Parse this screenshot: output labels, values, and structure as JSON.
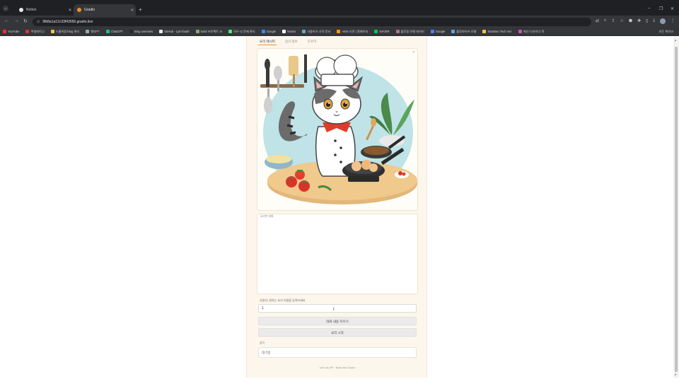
{
  "browser": {
    "tabs": [
      {
        "title": "Notion",
        "active": false,
        "favicon_color": "#e8e8e8"
      },
      {
        "title": "Gradio",
        "active": true,
        "favicon_color": "#f28c28"
      }
    ],
    "url": "9fb8a1a12c33f42656.gradio.live",
    "bookmarks": [
      {
        "label": "YouTube",
        "color": "#ff2d2d"
      },
      {
        "label": "쿠팡파트너",
        "color": "#d33"
      },
      {
        "label": "드롭쉬핑 blog 관리",
        "color": "#f5c542"
      },
      {
        "label": "챗GPT",
        "color": "#9aa"
      },
      {
        "label": "ChatGPT",
        "color": "#19c37d"
      },
      {
        "label": "Bing overview",
        "color": "#2a2b2e"
      },
      {
        "label": "GitHub - LyKi-fauth",
        "color": "#e8e8e8"
      },
      {
        "label": "build 프로젝트 AI",
        "color": "#8a6"
      },
      {
        "label": "모두 다 문제 관리",
        "color": "#4e7"
      },
      {
        "label": "Google",
        "color": "#4285f4"
      },
      {
        "label": "Notion",
        "color": "#fff"
      },
      {
        "label": "사용하기 시작 문서",
        "color": "#6ab"
      },
      {
        "label": "AWS 리전 | 홈페이지",
        "color": "#f90"
      },
      {
        "label": "NAVER",
        "color": "#03c75a"
      },
      {
        "label": "블루핑 모델 데이터",
        "color": "#a78"
      },
      {
        "label": "Google",
        "color": "#4285f4"
      },
      {
        "label": "블루파이프 모델",
        "color": "#5ad"
      },
      {
        "label": "StanDen Tech Ver.",
        "color": "#f5c542"
      },
      {
        "label": "최신 디자이너 학",
        "color": "#c5a"
      }
    ],
    "bookmarks_right": "모든 북마크"
  },
  "app": {
    "tabs": [
      "요리 레시피",
      "음식 정보",
      "도우미"
    ],
    "selected_tab": 0,
    "chat_label": "요리봇 대화",
    "input_label": "사용자: 원하는 요리 이름을 입력하세요",
    "input_value": "1",
    "clear_button": "대화 내용 지우기",
    "start_button": "요리 시작",
    "output_label": "출력",
    "output_value": "대기중",
    "footer": "Use via API · Built with Gradio"
  },
  "colors": {
    "accent": "#f28c28",
    "panel_bg": "#fdf6ec"
  }
}
